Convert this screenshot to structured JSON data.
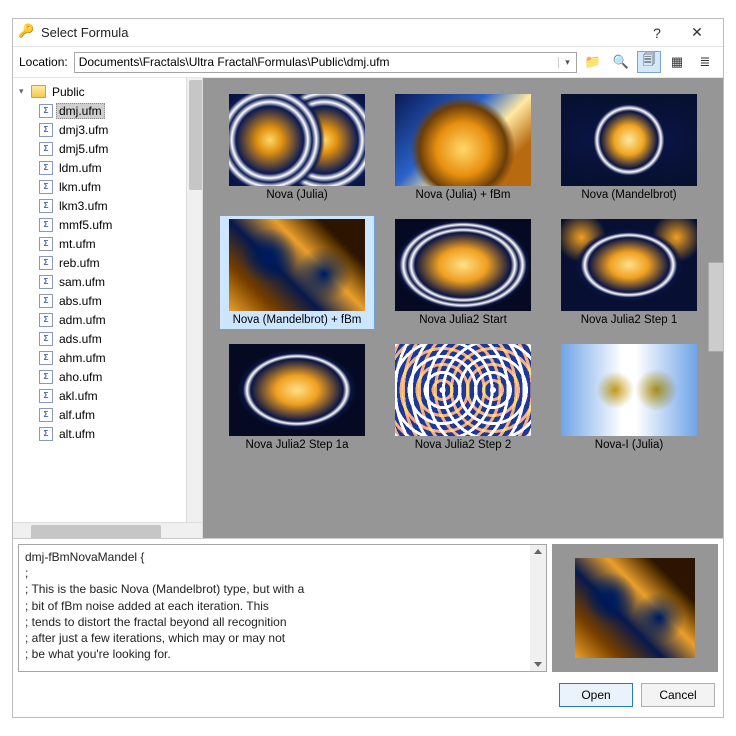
{
  "title": "Select Formula",
  "titlebar": {
    "help": "?",
    "close": "✕"
  },
  "location": {
    "label": "Location:",
    "path": "Documents\\Fractals\\Ultra Fractal\\Formulas\\Public\\dmj.ufm"
  },
  "toolbar": {
    "up_tooltip": "Up",
    "find_tooltip": "Find",
    "copy_tooltip": "Copy",
    "thumbs_tooltip": "Thumbnails",
    "list_tooltip": "List"
  },
  "tree": {
    "root": "Public",
    "items": [
      "dmj.ufm",
      "dmj3.ufm",
      "dmj5.ufm",
      "ldm.ufm",
      "lkm.ufm",
      "lkm3.ufm",
      "mmf5.ufm",
      "mt.ufm",
      "reb.ufm",
      "sam.ufm",
      "abs.ufm",
      "adm.ufm",
      "ads.ufm",
      "ahm.ufm",
      "aho.ufm",
      "akl.ufm",
      "alf.ufm",
      "alt.ufm"
    ],
    "selected_index": 0
  },
  "grid": {
    "items": [
      {
        "label": "Nova (Julia)",
        "style": "fract-a"
      },
      {
        "label": "Nova (Julia) + fBm",
        "style": "fract-b"
      },
      {
        "label": "Nova (Mandelbrot)",
        "style": "fract-c"
      },
      {
        "label": "Nova (Mandelbrot) + fBm",
        "style": "fract-d"
      },
      {
        "label": "Nova Julia2 Start",
        "style": "fract-e"
      },
      {
        "label": "Nova Julia2 Step 1",
        "style": "fract-f"
      },
      {
        "label": "Nova Julia2 Step 1a",
        "style": "fract-g"
      },
      {
        "label": "Nova Julia2 Step 2",
        "style": "fract-h"
      },
      {
        "label": "Nova-I (Julia)",
        "style": "fract-i"
      }
    ],
    "selected_index": 3
  },
  "description": {
    "lines": [
      "dmj-fBmNovaMandel {",
      ";",
      "; This is the basic Nova (Mandelbrot) type, but with a",
      "; bit of fBm noise added at each iteration. This",
      "; tends to distort the fractal beyond all recognition",
      "; after just a few iterations, which may or may not",
      "; be what you're looking for."
    ]
  },
  "preview_style": "fract-d",
  "buttons": {
    "open": "Open",
    "cancel": "Cancel"
  }
}
